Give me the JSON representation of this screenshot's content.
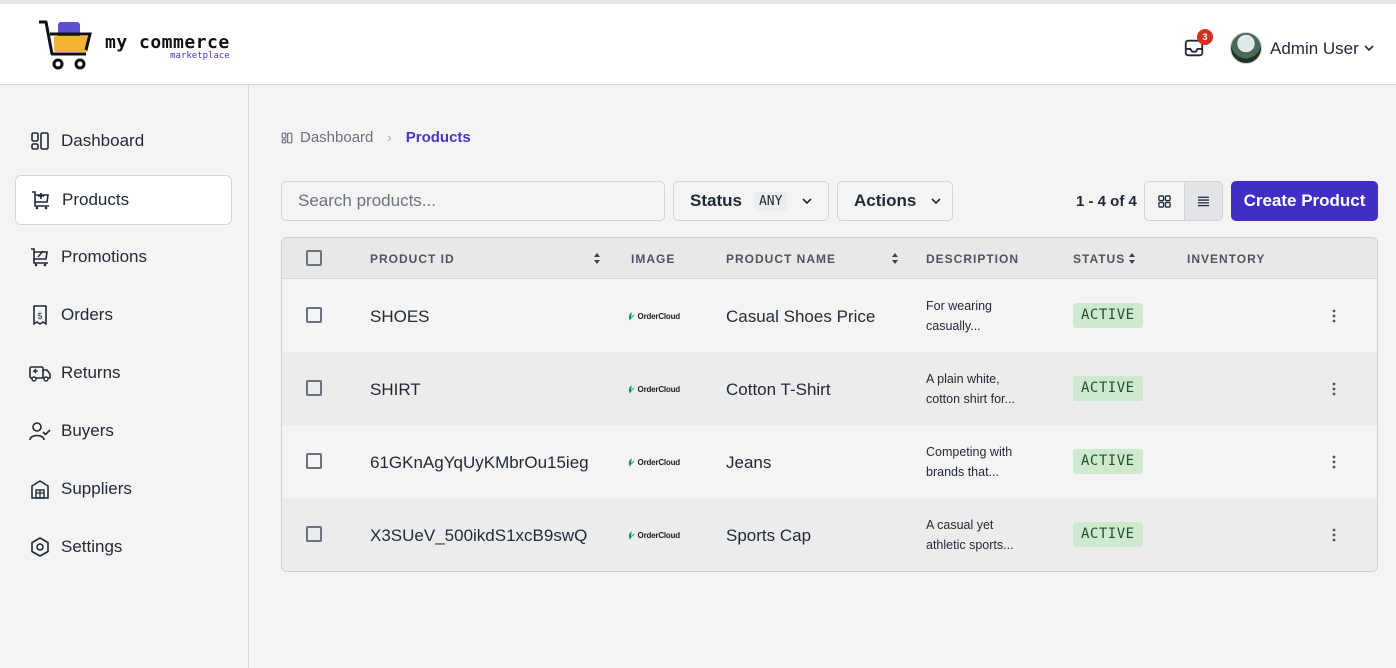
{
  "brand": {
    "name": "my commerce",
    "tagline": "marketplace"
  },
  "header": {
    "notification_count": "3",
    "user_name": "Admin User"
  },
  "sidebar": {
    "items": [
      {
        "label": "Dashboard",
        "icon": "dashboard-icon"
      },
      {
        "label": "Products",
        "icon": "products-icon",
        "active": true
      },
      {
        "label": "Promotions",
        "icon": "promotions-icon"
      },
      {
        "label": "Orders",
        "icon": "orders-icon"
      },
      {
        "label": "Returns",
        "icon": "returns-icon"
      },
      {
        "label": "Buyers",
        "icon": "buyers-icon"
      },
      {
        "label": "Suppliers",
        "icon": "suppliers-icon"
      },
      {
        "label": "Settings",
        "icon": "settings-icon"
      }
    ]
  },
  "breadcrumb": {
    "home": "Dashboard",
    "current": "Products"
  },
  "toolbar": {
    "search_placeholder": "Search products...",
    "status_label": "Status",
    "status_value": "ANY",
    "actions_label": "Actions",
    "paging": "1 - 4 of 4",
    "create_label": "Create Product"
  },
  "table": {
    "columns": [
      "PRODUCT ID",
      "IMAGE",
      "PRODUCT NAME",
      "DESCRIPTION",
      "STATUS",
      "INVENTORY"
    ],
    "image_brand": "OrderCloud",
    "rows": [
      {
        "id": "SHOES",
        "name": "Casual Shoes Price",
        "desc1": "For wearing",
        "desc2": "casually...",
        "status": "ACTIVE"
      },
      {
        "id": "SHIRT",
        "name": "Cotton T-Shirt",
        "desc1": "A plain white,",
        "desc2": "cotton shirt for...",
        "status": "ACTIVE"
      },
      {
        "id": "61GKnAgYqUyKMbrOu15ieg",
        "name": "Jeans",
        "desc1": "Competing with",
        "desc2": "brands that...",
        "status": "ACTIVE"
      },
      {
        "id": "X3SUeV_500ikdS1xcB9swQ",
        "name": "Sports Cap",
        "desc1": "A casual yet",
        "desc2": "athletic sports...",
        "status": "ACTIVE"
      }
    ]
  },
  "colors": {
    "accent": "#3f2fc4",
    "active_badge": "#cfe9d1",
    "notification": "#d92d20"
  }
}
